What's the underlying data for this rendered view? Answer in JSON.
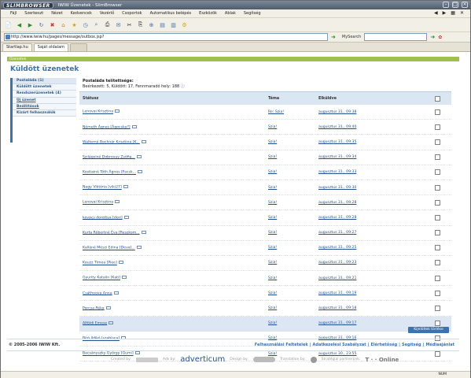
{
  "window": {
    "logo": "SLIMBROWSER",
    "title": "IWIW Üzenetek - SlimBrowser"
  },
  "menu": [
    "Fájl",
    "Szerkeszt",
    "Nézet",
    "Kedvencek",
    "Vezérlő",
    "Csoportok",
    "Automatikus belépés",
    "Eszközök",
    "Ablak",
    "Segítség"
  ],
  "address": {
    "url": "http://www.iwiw.hu/pages/message/outbox.jsp?",
    "search_label": "MySearch"
  },
  "tabs": [
    "Startlap.hu",
    "Saját oldalam",
    ""
  ],
  "page": {
    "banner": "Üzenetek",
    "title": "Küldött üzenetek",
    "sidebar": [
      {
        "label": "Postaláda (1)",
        "selected": true
      },
      {
        "label": "Küldött üzenetek",
        "selected": false
      },
      {
        "label": "Rendszerüzenetek (4)",
        "selected": false
      },
      {
        "label": "Új üzenet",
        "selected": false
      },
      {
        "label": "Beállítások",
        "selected": false
      },
      {
        "label": "Kizárt felhasználók",
        "selected": false
      }
    ],
    "status_title": "Postaláda telítettsége:",
    "status_text": "Beérkezett: 5, Küldött: 17, Fennmaradó hely: 188",
    "columns": {
      "status": "Státusz",
      "subject": "Téma",
      "sent": "Elküldve"
    },
    "rows": [
      {
        "name": "Lenovai Krisztina",
        "subject": "Re: Szia!",
        "sent": "augusztus 31., 09:38",
        "hl": false
      },
      {
        "name": "Németh Ágnes [Ágocska?]",
        "subject": "Szia!",
        "sent": "augusztus 31., 09:40",
        "hl": false
      },
      {
        "name": "Walterné Bochnár Krisztina [K...",
        "subject": "Szia!",
        "sent": "augusztus 31., 09:35",
        "hl": false
      },
      {
        "name": "Szilágyiné Dobrovay Zsófia...",
        "subject": "Szia!",
        "sent": "augusztus 31., 09:34",
        "hl": false
      },
      {
        "name": "Kostiainé Tóth Ágnes [Fecsk...",
        "subject": "Szia!",
        "sent": "augusztus 31., 09:33",
        "hl": false
      },
      {
        "name": "Nagy Viktória [viki27]",
        "subject": "Szia!",
        "sent": "augusztus 31., 09:30",
        "hl": false
      },
      {
        "name": "Lenovai Krisztina",
        "subject": "Szia!",
        "sent": "augusztus 31., 09:28",
        "hl": false
      },
      {
        "name": "kovács dorottya [dori]",
        "subject": "Szia!",
        "sent": "augusztus 31., 09:28",
        "hl": false
      },
      {
        "name": "Kurta Róbertné Éva [Reszkom...",
        "subject": "Szia!",
        "sent": "augusztus 31., 09:27",
        "hl": false
      },
      {
        "name": "Kalláné Mészi Edina [Deva]...",
        "subject": "Szia!",
        "sent": "augusztus 31., 09:25",
        "hl": false
      },
      {
        "name": "Kauzz Tímea [Piee]",
        "subject": "Szia!",
        "sent": "augusztus 31., 09:23",
        "hl": false
      },
      {
        "name": "Gyurity Katalin [Kati]",
        "subject": "Szia!",
        "sent": "augusztus 31., 09:21",
        "hl": false
      },
      {
        "name": "Csáthoova Anna",
        "subject": "Szia!",
        "sent": "augusztus 31., 09:19",
        "hl": false
      },
      {
        "name": "Porcsa Réka",
        "subject": "Szia!",
        "sent": "augusztus 31., 09:18",
        "hl": false
      },
      {
        "name": "Alföldi Emese",
        "subject": "Szia!",
        "sent": "augusztus 31., 09:17",
        "hl": true
      },
      {
        "name": "Bíró Ildikó [vrabisca]",
        "subject": "Szia!",
        "sent": "augusztus 31., 09:16",
        "hl": false
      },
      {
        "name": "Bacsányszky György [Gumi]",
        "subject": "Szia!",
        "sent": "augusztus 30., 23:55",
        "hl": false
      }
    ],
    "delete_button": "Kijelöltek törlése",
    "copyright": "© 2005-2006 IWIW Kft.",
    "footer_links": [
      "Felhasználási Feltételek",
      "Adatkezelési Szabályzat",
      "Elérhetőség",
      "Segítség",
      "Médiaajánlat"
    ],
    "credits": {
      "created_by": "Created by:",
      "ads_by": "Ads by:",
      "adverticum": "adverticum",
      "design_by": "Design by:",
      "translation_by": "Translation by:",
      "partner": "Stratégiai partnerünk:",
      "tonline": "T · · Online"
    }
  },
  "statusbar": "NUM"
}
